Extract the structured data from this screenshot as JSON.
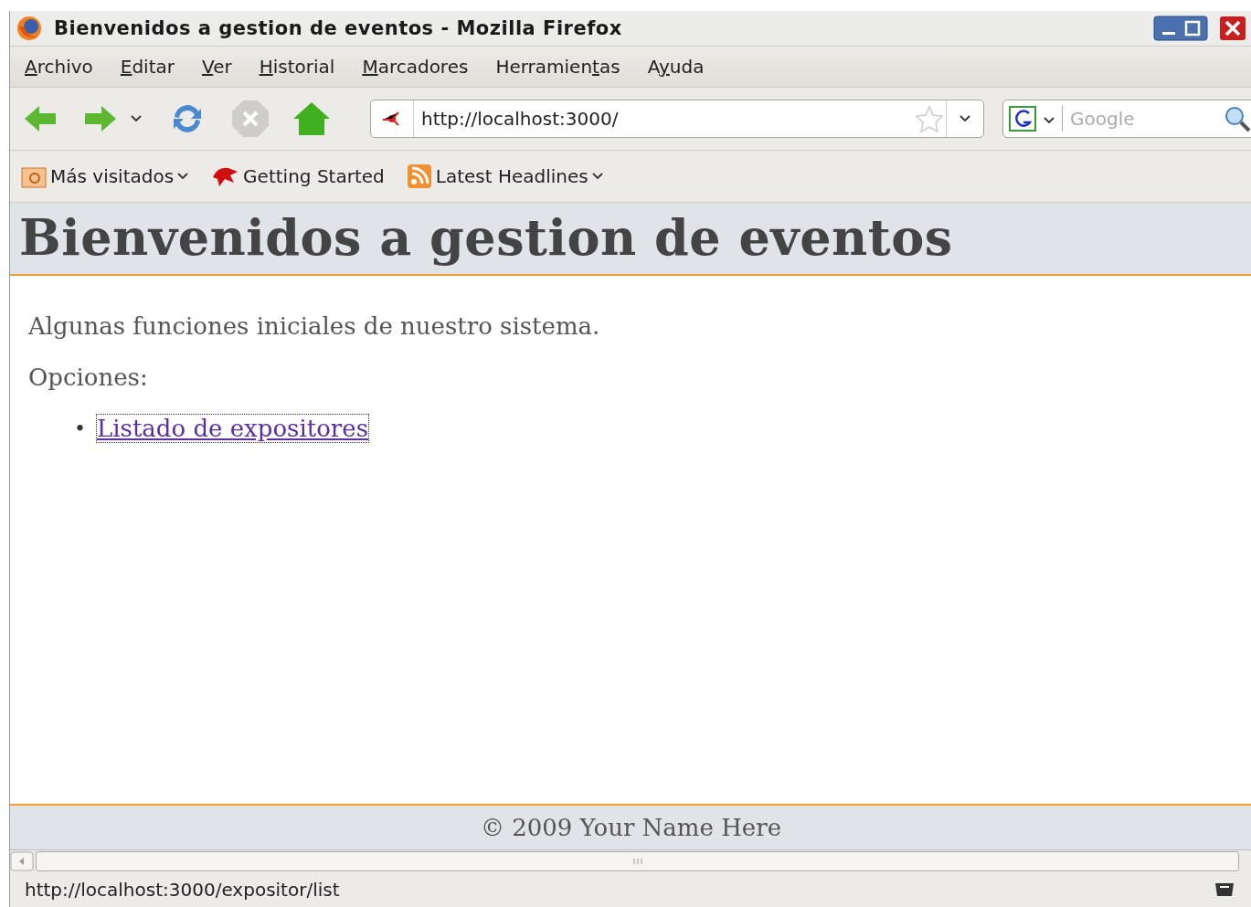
{
  "window": {
    "title": "Bienvenidos a gestion de eventos - Mozilla Firefox"
  },
  "menu": [
    {
      "key": "A",
      "post": "rchivo"
    },
    {
      "key": "E",
      "post": "ditar"
    },
    {
      "key": "V",
      "post": "er"
    },
    {
      "key": "H",
      "post": "istorial"
    },
    {
      "key": "M",
      "post": "arcadores"
    },
    {
      "pre": "Herramien",
      "key": "t",
      "post": "as"
    },
    {
      "pre": "A",
      "key": "y",
      "post": "uda"
    }
  ],
  "address": {
    "value": "http://localhost:3000/"
  },
  "search": {
    "placeholder": "Google"
  },
  "bookmarks": [
    {
      "label": "Más visitados",
      "kind": "folder",
      "dropdown": true
    },
    {
      "label": "Getting Started",
      "kind": "page",
      "dropdown": false
    },
    {
      "label": "Latest Headlines",
      "kind": "feed",
      "dropdown": true
    }
  ],
  "page": {
    "heading": "Bienvenidos a gestion de eventos",
    "intro": "Algunas funciones iniciales de nuestro sistema.",
    "options_label": "Opciones:",
    "links": [
      {
        "marker": "•",
        "label": "Listado de expositores",
        "focused": true
      }
    ],
    "footer": "© 2009 Your Name Here"
  },
  "status_bar": {
    "text": "http://localhost:3000/expositor/list"
  }
}
